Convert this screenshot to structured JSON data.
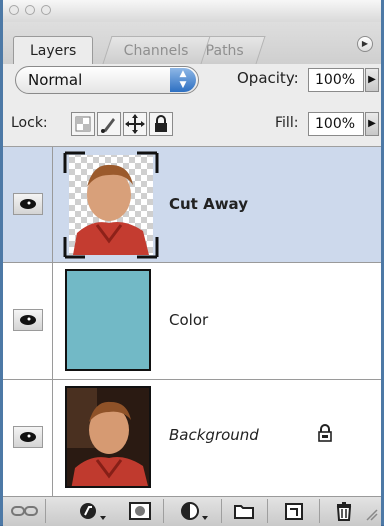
{
  "tabs": [
    {
      "label": "Layers",
      "active": true
    },
    {
      "label": "Channels",
      "active": false
    },
    {
      "label": "Paths",
      "active": false
    }
  ],
  "blend_mode": "Normal",
  "opacity": {
    "label": "Opacity:",
    "value": "100%"
  },
  "lock": {
    "label": "Lock:"
  },
  "fill": {
    "label": "Fill:",
    "value": "100%"
  },
  "layers": [
    {
      "name": "Cut Away",
      "selected": true,
      "bold": true,
      "thumb": "photo-masked"
    },
    {
      "name": "Color",
      "selected": false,
      "bold": false,
      "thumb": "color-fill",
      "color": "#72b9c6"
    },
    {
      "name": "Background",
      "selected": false,
      "italic": true,
      "locked": true,
      "thumb": "photo"
    }
  ],
  "colors": {
    "selected_row": "#cdd9ec",
    "fill_swatch": "#72b9c6",
    "frame": "#4d79a6"
  }
}
